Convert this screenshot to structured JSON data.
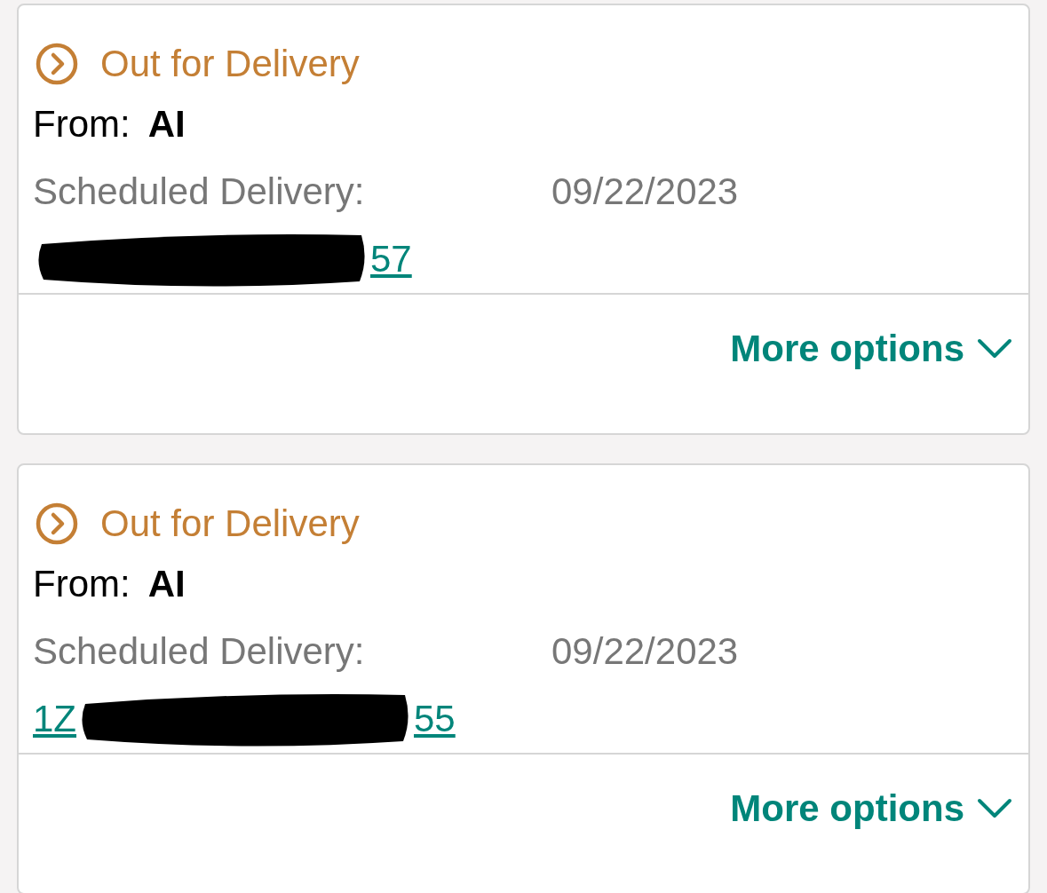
{
  "shipments": [
    {
      "status": "Out for Delivery",
      "from_label": "From:",
      "from": "AI",
      "scheduled_label": "Scheduled Delivery:",
      "scheduled_date": "09/22/2023",
      "tracking_visible_end": "57",
      "more_options": "More options"
    },
    {
      "status": "Out for Delivery",
      "from_label": "From:",
      "from": "AI",
      "scheduled_label": "Scheduled Delivery:",
      "scheduled_date": "09/22/2023",
      "tracking_visible_start": "1Z",
      "tracking_visible_end": "55",
      "more_options": "More options"
    }
  ]
}
